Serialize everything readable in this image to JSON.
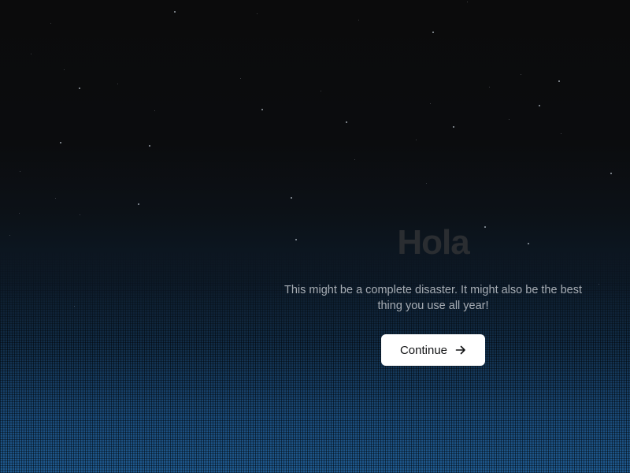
{
  "page": {
    "title": "Hola",
    "message": "This might be a complete disaster. It might also be the best thing you use all year!",
    "continue_label": "Continue",
    "continue_icon": "arrow-right-icon"
  },
  "colors": {
    "background_top": "#0b0b0c",
    "background_bottom": "#1f5a90",
    "title": "#2a2d31",
    "message": "#a7adb4",
    "button_bg": "#ffffff",
    "button_text": "#111214"
  }
}
